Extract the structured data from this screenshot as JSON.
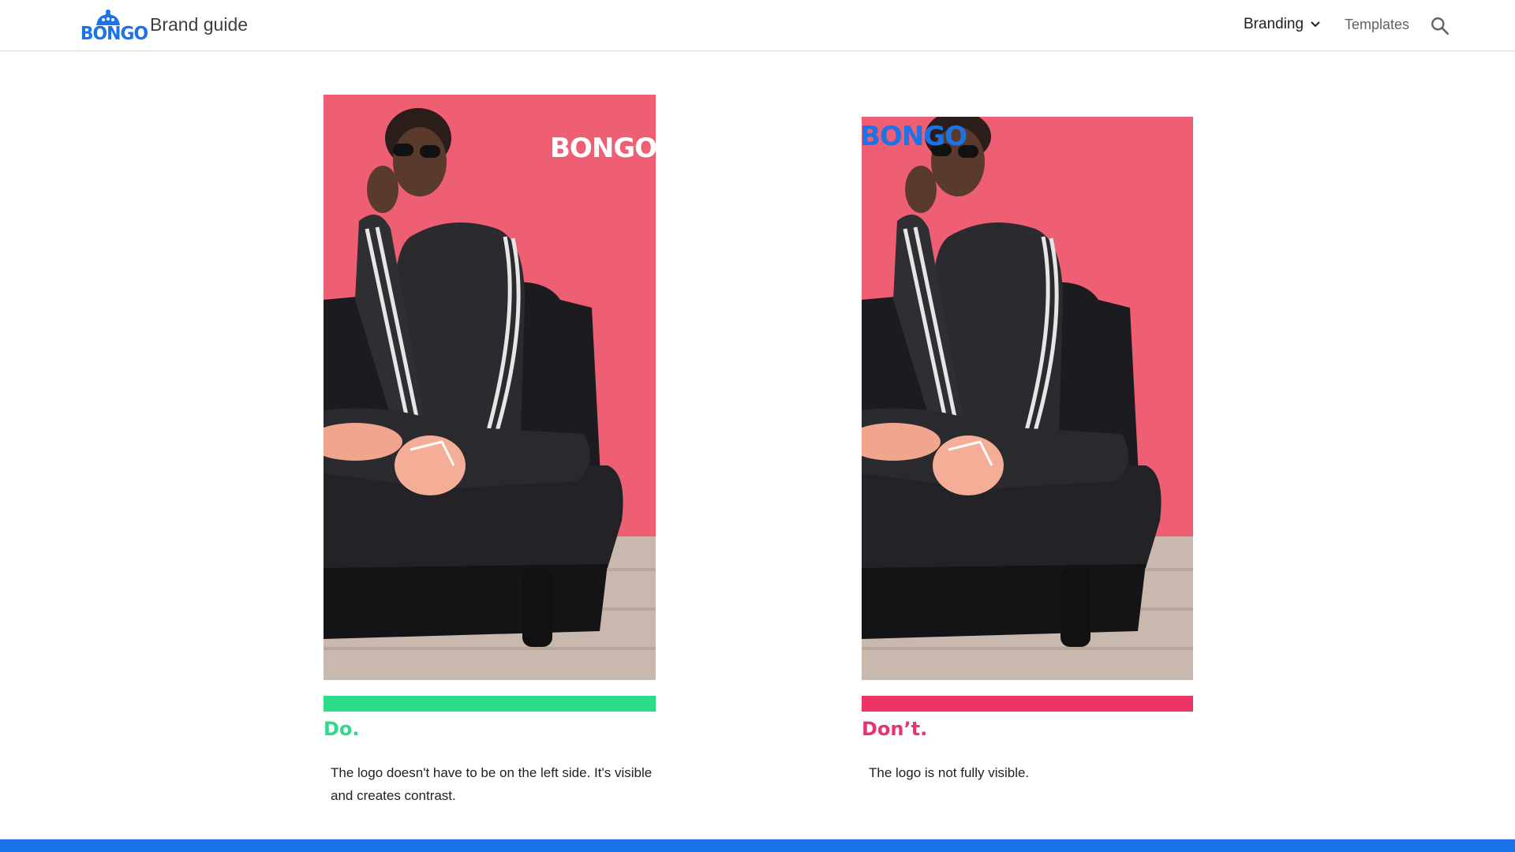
{
  "header": {
    "logo_text": "BONGO",
    "site_title": "Brand guide",
    "nav": {
      "branding_label": "Branding",
      "templates_label": "Templates"
    },
    "icons": [
      "chevron-down-icon",
      "search-icon"
    ]
  },
  "examples": {
    "do": {
      "overlay_logo": "BONGO",
      "verdict": "Do.",
      "description": "The logo doesn't have to be on the left side. It's visible and creates contrast."
    },
    "dont": {
      "overlay_logo": "BONGO",
      "verdict": "Don’t.",
      "description": "The logo is not fully visible."
    }
  },
  "colors": {
    "brand_blue": "#1a73e8",
    "do_green": "#2edb8a",
    "dont_pink": "#ee3464",
    "photo_background": "#ee5a70"
  }
}
